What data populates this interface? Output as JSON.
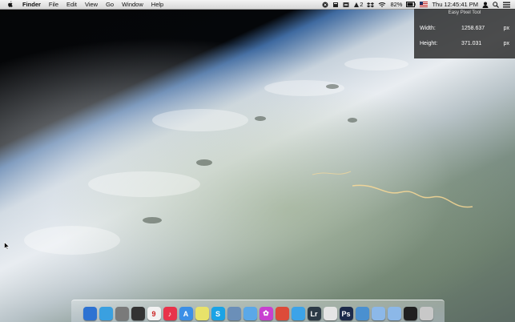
{
  "menubar": {
    "apple_icon": "apple-icon",
    "app_name": "Finder",
    "menus": [
      "File",
      "Edit",
      "View",
      "Go",
      "Window",
      "Help"
    ]
  },
  "status_bar": {
    "badge_count": "2",
    "battery_percent": "82%",
    "clock": "Thu 12:45:41 PM",
    "icons": [
      "xcode-icon",
      "document-icon",
      "archive-icon",
      "notification-icon",
      "dropbox-icon",
      "wifi-icon",
      "battery-icon",
      "flag-icon",
      "user-icon",
      "spotlight-icon",
      "list-icon"
    ]
  },
  "pixel_tool": {
    "title": "Easy Pixel Tool",
    "width_label": "Width:",
    "width_value": "1258.637",
    "width_unit": "px",
    "height_label": "Height:",
    "height_value": "371.031",
    "height_unit": "px"
  },
  "dock": {
    "apps": [
      {
        "name": "finder",
        "color": "#2d72d2",
        "glyph": ""
      },
      {
        "name": "mission-control",
        "color": "#3aa0e0",
        "glyph": ""
      },
      {
        "name": "system-preferences",
        "color": "#7a7a7a",
        "glyph": ""
      },
      {
        "name": "dashboard",
        "color": "#333333",
        "glyph": ""
      },
      {
        "name": "calendar",
        "color": "#f2f2f2",
        "glyph": "9"
      },
      {
        "name": "itunes",
        "color": "#e8334a",
        "glyph": "♪"
      },
      {
        "name": "app-store",
        "color": "#3b8fe6",
        "glyph": "A"
      },
      {
        "name": "stickies",
        "color": "#e8e26a",
        "glyph": ""
      },
      {
        "name": "skype",
        "color": "#1aa3e6",
        "glyph": "S"
      },
      {
        "name": "preview",
        "color": "#6b8fb8",
        "glyph": ""
      },
      {
        "name": "safari",
        "color": "#5aa8e8",
        "glyph": ""
      },
      {
        "name": "photo-app",
        "color": "#c840d0",
        "glyph": "✿"
      },
      {
        "name": "chrome",
        "color": "#dd4b39",
        "glyph": ""
      },
      {
        "name": "twitter",
        "color": "#3ca3e8",
        "glyph": ""
      },
      {
        "name": "lightroom",
        "color": "#2c3a46",
        "glyph": "Lr"
      },
      {
        "name": "script-editor",
        "color": "#e5e5e5",
        "glyph": ""
      },
      {
        "name": "photoshop",
        "color": "#1c2a4a",
        "glyph": "Ps"
      },
      {
        "name": "xcode",
        "color": "#4a90d0",
        "glyph": ""
      },
      {
        "name": "folder",
        "color": "#8cb8e8",
        "glyph": ""
      },
      {
        "name": "folder-2",
        "color": "#8cb8e8",
        "glyph": ""
      },
      {
        "name": "terminal",
        "color": "#202020",
        "glyph": ""
      },
      {
        "name": "trash",
        "color": "#c8c8c8",
        "glyph": ""
      }
    ]
  }
}
